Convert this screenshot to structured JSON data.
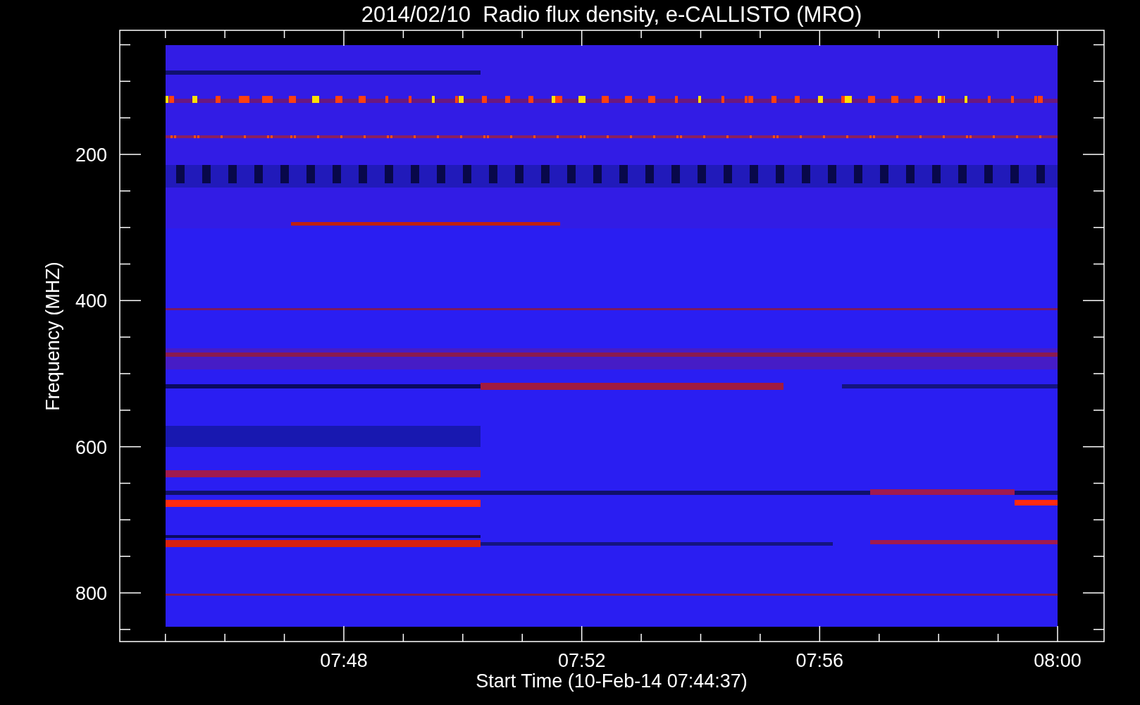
{
  "title": "2014/02/10  Radio flux density, e-CALLISTO (MRO)",
  "plot": {
    "xlabel": "Start Time (10-Feb-14 07:44:37)",
    "ylabel": "Frequency (MHZ)",
    "xtick_labels": [
      "07:48",
      "07:52",
      "07:56",
      "08:00"
    ],
    "ytick_labels": [
      "200",
      "400",
      "600",
      "800"
    ]
  }
}
